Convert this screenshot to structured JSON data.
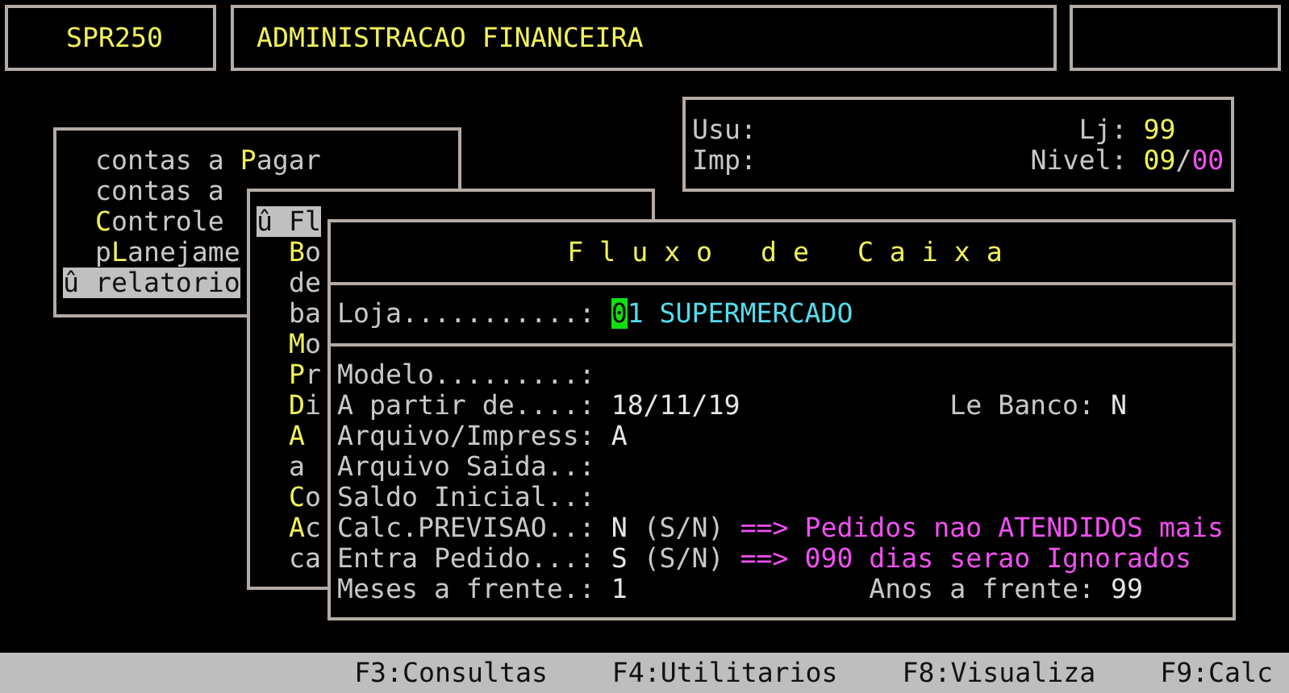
{
  "header": {
    "program_code": "SPR250",
    "system_title": "ADMINISTRACAO FINANCEIRA"
  },
  "session": {
    "user_label": "Usu:",
    "printer_label": "Imp:",
    "store_label": "Lj:",
    "store_value": "99",
    "level_label": "Nivel:",
    "level_value": "09",
    "level_separator": "/",
    "level_max": "00"
  },
  "main_menu": [
    {
      "label": "contas a **P**agar",
      "selected": false
    },
    {
      "label": "contas a",
      "selected": false
    },
    {
      "label": "**C**ontrole",
      "selected": false
    },
    {
      "label": "p**L**anejame",
      "selected": false
    },
    {
      "label": "û relatorio",
      "selected": true
    }
  ],
  "submenu": [
    {
      "label": "û Fl",
      "selected": true
    },
    {
      "label": "**B**o",
      "selected": false
    },
    {
      "label": "de",
      "selected": false
    },
    {
      "label": "ba",
      "selected": false
    },
    {
      "label": "**M**o",
      "selected": false
    },
    {
      "label": "**P**r",
      "selected": false
    },
    {
      "label": "**D**i",
      "selected": false
    },
    {
      "label": "**A**",
      "selected": false
    },
    {
      "label": "a",
      "selected": false
    },
    {
      "label": "**C**o",
      "selected": false
    },
    {
      "label": "**A**c",
      "selected": false
    },
    {
      "label": "ca",
      "selected": false
    }
  ],
  "dialog": {
    "title": "F l u x o   d e   C a i x a",
    "store": {
      "label": "Loja...........:",
      "cursor_char": "0",
      "value": "1 SUPERMERCADO",
      "cursor": true
    },
    "fields": [
      {
        "kind": "plain",
        "label": "Modelo.........:"
      },
      {
        "kind": "option",
        "label": "A partir de....:",
        "value": "18/11/19",
        "side_label": "Le Banco:",
        "side_value": "N"
      },
      {
        "kind": "plain",
        "label": "Arquivo/Impress:",
        "value": "A"
      },
      {
        "kind": "plain",
        "label": "Arquivo Saida..:"
      },
      {
        "kind": "plain",
        "label": "Saldo Inicial..:"
      },
      {
        "kind": "note",
        "label": "Calc.PREVISAO..:",
        "value": "N",
        "hint": "(S/N)",
        "note": "==> Pedidos nao ATENDIDOS mais"
      },
      {
        "kind": "note",
        "label": "Entra Pedido...:",
        "value": "S",
        "hint": "(S/N)",
        "note": "==> 090 dias serao Ignorados"
      },
      {
        "kind": "total",
        "label": "Meses a frente.:",
        "value": "1",
        "side_label": "Anos a frente:",
        "side_value": "99"
      }
    ]
  },
  "function_keys": [
    "F3:Consultas",
    "F4:Utilitarios",
    "F8:Visualiza",
    "F9:Calc"
  ]
}
